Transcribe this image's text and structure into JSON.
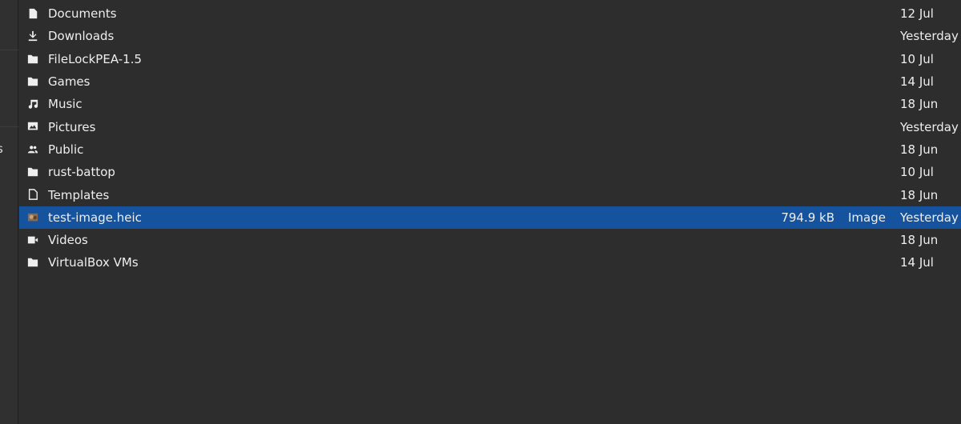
{
  "sidebar": {
    "partial_label": "s"
  },
  "files": [
    {
      "name": "Documents",
      "icon": "document-icon",
      "size": "",
      "type": "",
      "modified": "12 Jul"
    },
    {
      "name": "Downloads",
      "icon": "download-icon",
      "size": "",
      "type": "",
      "modified": "Yesterday"
    },
    {
      "name": "FileLockPEA-1.5",
      "icon": "folder-icon",
      "size": "",
      "type": "",
      "modified": "10 Jul"
    },
    {
      "name": "Games",
      "icon": "folder-icon",
      "size": "",
      "type": "",
      "modified": "14 Jul"
    },
    {
      "name": "Music",
      "icon": "music-icon",
      "size": "",
      "type": "",
      "modified": "18 Jun"
    },
    {
      "name": "Pictures",
      "icon": "pictures-icon",
      "size": "",
      "type": "",
      "modified": "Yesterday"
    },
    {
      "name": "Public",
      "icon": "public-icon",
      "size": "",
      "type": "",
      "modified": "18 Jun"
    },
    {
      "name": "rust-battop",
      "icon": "folder-icon",
      "size": "",
      "type": "",
      "modified": "10 Jul"
    },
    {
      "name": "Templates",
      "icon": "templates-icon",
      "size": "",
      "type": "",
      "modified": "18 Jun"
    },
    {
      "name": "test-image.heic",
      "icon": "image-thumbnail-icon",
      "size": "794.9 kB",
      "type": "Image",
      "modified": "Yesterday",
      "selected": true
    },
    {
      "name": "Videos",
      "icon": "video-icon",
      "size": "",
      "type": "",
      "modified": "18 Jun"
    },
    {
      "name": "VirtualBox VMs",
      "icon": "folder-icon",
      "size": "",
      "type": "",
      "modified": "14 Jul"
    }
  ],
  "colors": {
    "selection": "#15539e",
    "background": "#2d2d2d",
    "sidebar": "#303030"
  }
}
